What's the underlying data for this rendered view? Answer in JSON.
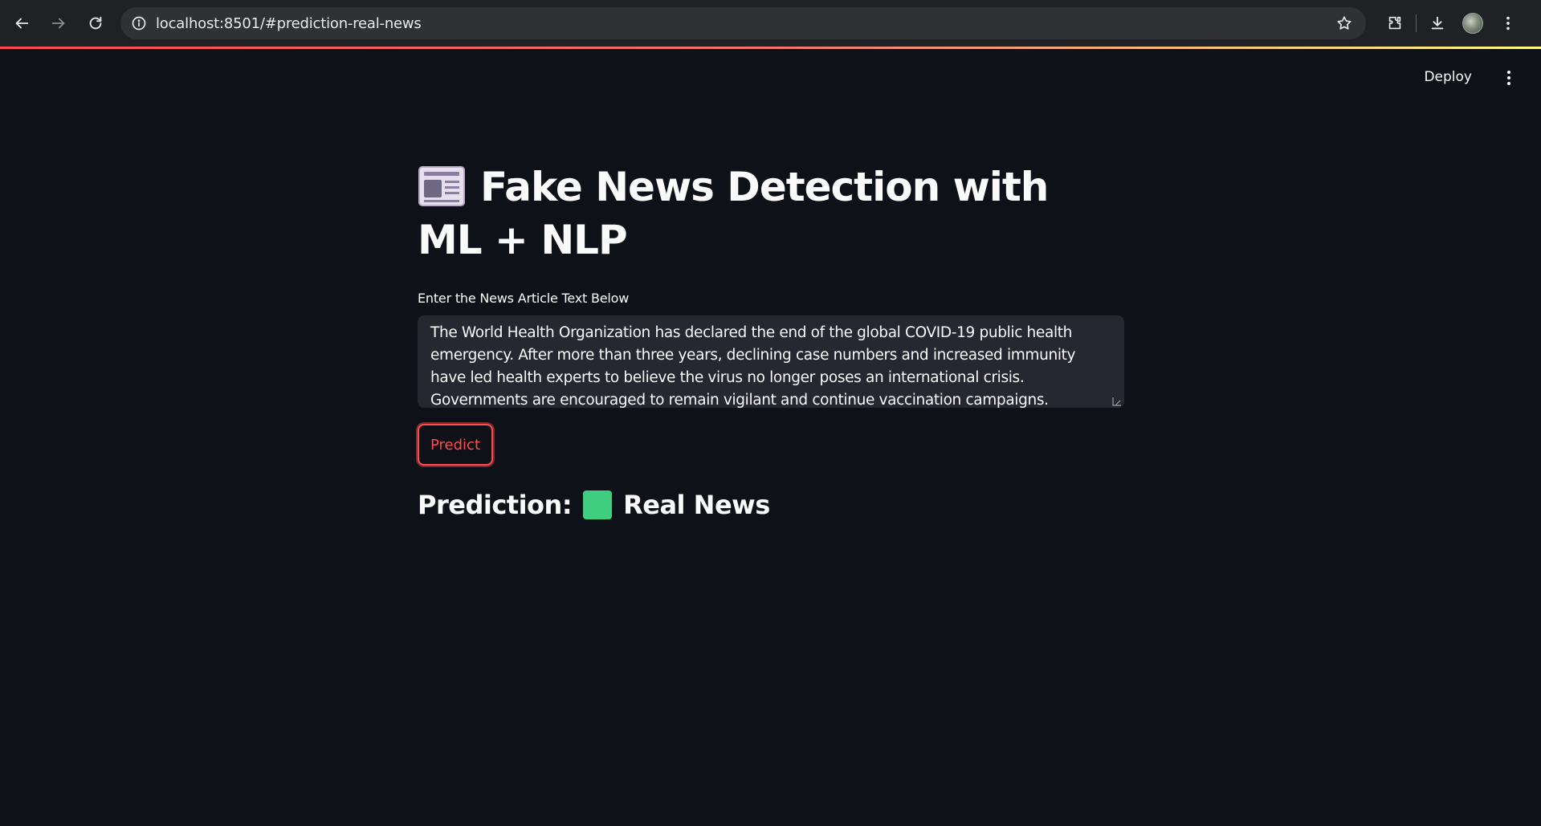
{
  "browser": {
    "url": "localhost:8501/#prediction-real-news",
    "icons": [
      "back-arrow-icon",
      "forward-arrow-icon",
      "reload-icon",
      "site-info-icon",
      "bookmark-star-icon",
      "extensions-icon",
      "download-icon",
      "profile-avatar",
      "browser-menu-icon"
    ]
  },
  "header": {
    "deploy_label": "Deploy",
    "menu_icon": "vertical-ellipsis-icon"
  },
  "main": {
    "title_icon": "newspaper-icon",
    "title": "Fake News Detection with ML + NLP",
    "input_label": "Enter the News Article Text Below",
    "input_value": "The World Health Organization has declared the end of the global COVID-19 public health emergency. After more than three years, declining case numbers and increased immunity have led health experts to believe the virus no longer poses an international crisis. Governments are encouraged to remain vigilant and continue vaccination campaigns.",
    "predict_label": "Predict",
    "prediction_label": "Prediction:",
    "prediction_result": "Real News",
    "result_icon": "green-square-icon"
  },
  "colors": {
    "background": "#0e1117",
    "accent": "#ff4b4b",
    "text": "#fafafa",
    "input_bg": "#262730",
    "result_green": "#3fce80"
  }
}
